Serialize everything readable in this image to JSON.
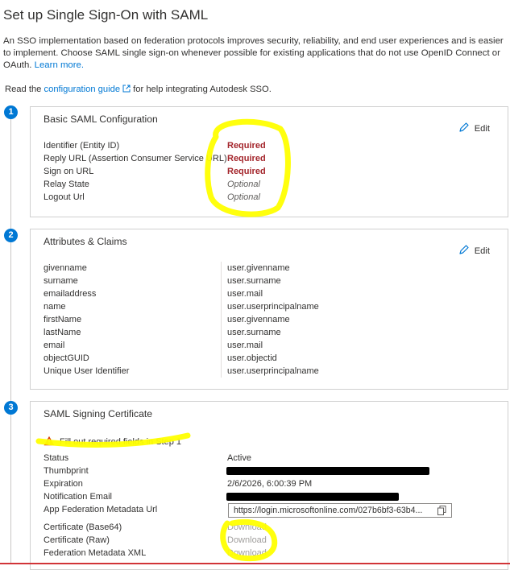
{
  "page": {
    "title": "Set up Single Sign-On with SAML",
    "intro_text": "An SSO implementation based on federation protocols improves security, reliability, and end user experiences and is easier to implement. Choose SAML single sign-on whenever possible for existing applications that do not use OpenID Connect or OAuth.",
    "learn_more": "Learn more.",
    "guide_prefix": "Read the",
    "guide_link": "configuration guide",
    "guide_suffix": "for help integrating Autodesk SSO."
  },
  "steps": [
    "1",
    "2",
    "3"
  ],
  "basic_saml": {
    "title": "Basic SAML Configuration",
    "edit": "Edit",
    "fields": [
      {
        "label": "Identifier (Entity ID)",
        "value": "Required"
      },
      {
        "label": "Reply URL (Assertion Consumer Service URL)",
        "value": "Required"
      },
      {
        "label": "Sign on URL",
        "value": "Required"
      },
      {
        "label": "Relay State",
        "value": "Optional"
      },
      {
        "label": "Logout Url",
        "value": "Optional"
      }
    ]
  },
  "attributes": {
    "title": "Attributes & Claims",
    "edit": "Edit",
    "rows": [
      {
        "name": "givenname",
        "value": "user.givenname"
      },
      {
        "name": "surname",
        "value": "user.surname"
      },
      {
        "name": "emailaddress",
        "value": "user.mail"
      },
      {
        "name": "name",
        "value": "user.userprincipalname"
      },
      {
        "name": "firstName",
        "value": "user.givenname"
      },
      {
        "name": "lastName",
        "value": "user.surname"
      },
      {
        "name": "email",
        "value": "user.mail"
      },
      {
        "name": "objectGUID",
        "value": "user.objectid"
      },
      {
        "name": "Unique User Identifier",
        "value": "user.userprincipalname"
      }
    ]
  },
  "certificate": {
    "title": "SAML Signing Certificate",
    "warning": "Fill out required fields in Step 1",
    "status_label": "Status",
    "status_value": "Active",
    "thumbprint_label": "Thumbprint",
    "expiration_label": "Expiration",
    "expiration_value": "2/6/2026, 6:00:39 PM",
    "notification_label": "Notification Email",
    "metadata_url_label": "App Federation Metadata Url",
    "metadata_url_value": "https://login.microsoftonline.com/027b6bf3-63b4...",
    "base64_label": "Certificate (Base64)",
    "raw_label": "Certificate (Raw)",
    "xml_label": "Federation Metadata XML",
    "download": "Download"
  },
  "colors": {
    "accent": "#0078d4",
    "required": "#a4262c",
    "highlight": "#ffff00",
    "warning": "#d83b01"
  },
  "icons": [
    "pencil-icon",
    "external-link-icon",
    "warning-icon",
    "copy-icon"
  ]
}
